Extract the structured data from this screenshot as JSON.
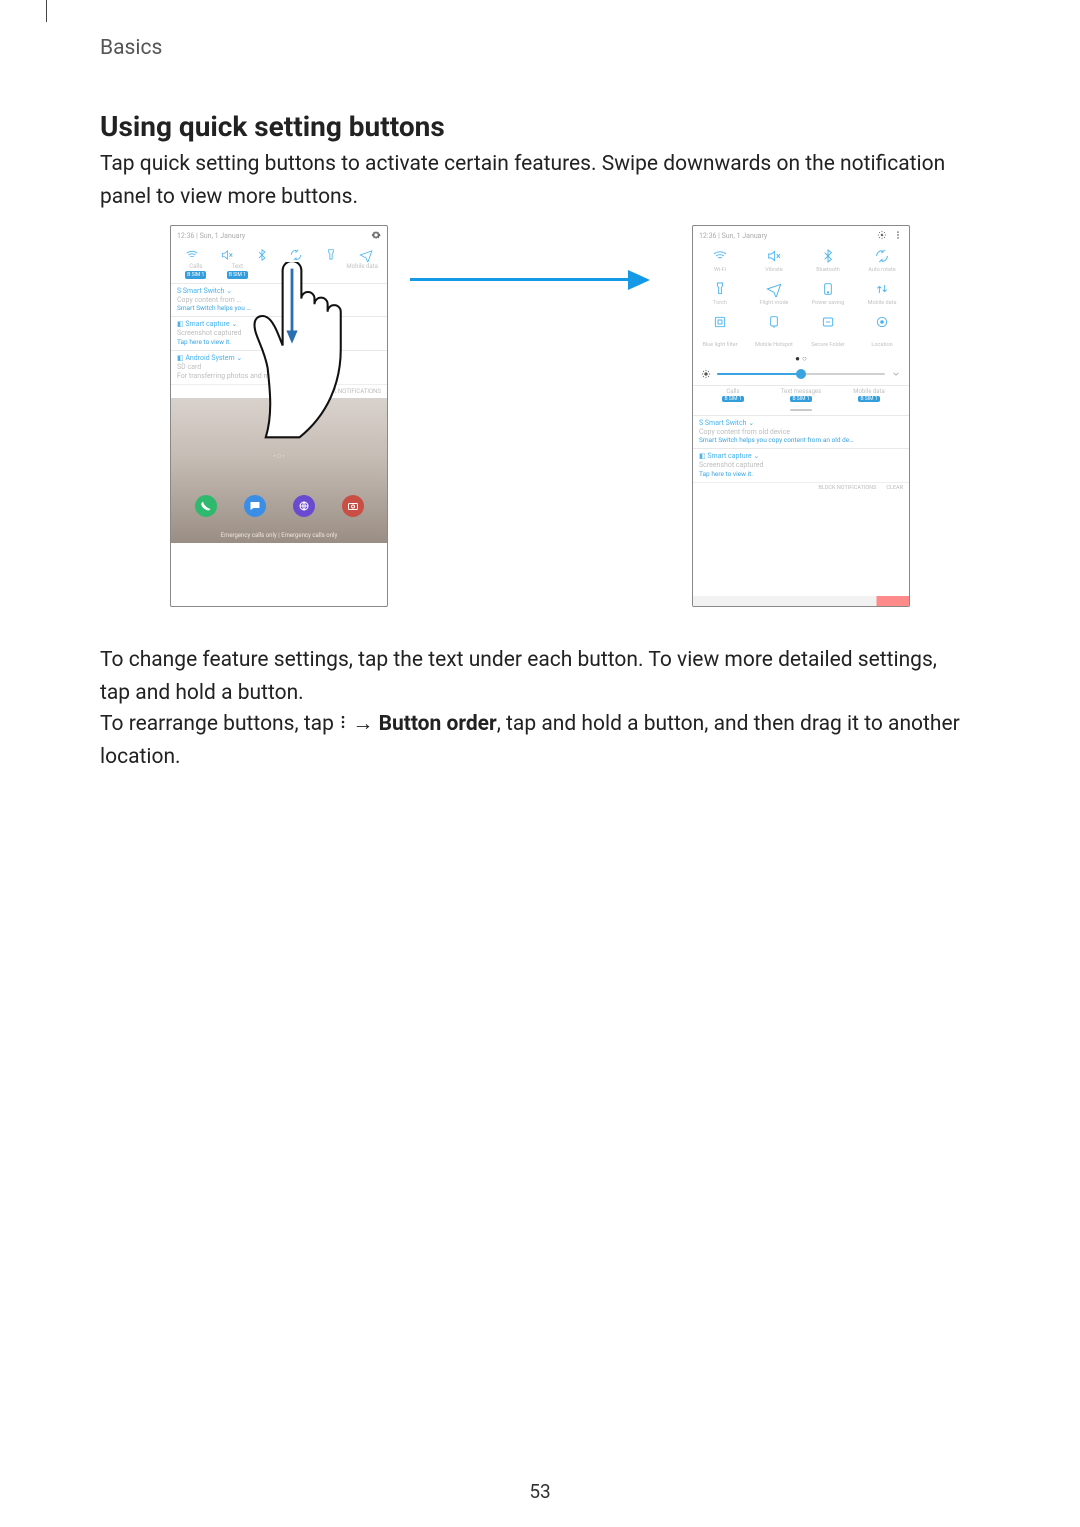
{
  "header": {
    "section": "Basics"
  },
  "heading": "Using quick setting buttons",
  "para1": "Tap quick setting buttons to activate certain features. Swipe downwards on the notification panel to view more buttons.",
  "para2": "To change feature settings, tap the text under each button. To view more detailed settings, tap and hold a button.",
  "para3_pre": "To rearrange buttons, tap ",
  "para3_arrow": " → ",
  "para3_bold": "Button order",
  "para3_post": ", tap and hold a button, and then drag it to another location.",
  "page_number": "53",
  "left_phone": {
    "time": "12:36 | Sun, 1 January",
    "sims": {
      "calls": "Calls",
      "texts": "Text",
      "data": "Mobile data",
      "sim": "B SIM 1"
    },
    "app1": {
      "name": "S  Smart Switch  ⌄",
      "line1": "Copy content from …",
      "line2": "Smart Switch helps you …"
    },
    "app2": {
      "name": "◧  Smart capture  ⌄",
      "line1": "Screenshot captured",
      "line2": "Tap here to view it."
    },
    "app3": {
      "name": "◧  Android System  ⌄",
      "line1": "SD card",
      "line2": "For transferring photos and media"
    },
    "block": "BLOCK NOTIFICATIONS",
    "emergency": "Emergency calls only | Emergency calls only"
  },
  "right_phone": {
    "time": "12:36 | Sun, 1 January",
    "qs": [
      "Wi-Fi",
      "Vibrate",
      "Bluetooth",
      "Auto rotate",
      "Torch",
      "Flight mode",
      "Power saving",
      "Mobile data",
      "",
      "",
      "",
      "",
      "Blue light filter",
      "Mobile Hotspot",
      "Secure Folder",
      "Location"
    ],
    "sims": {
      "calls": "Calls",
      "texts": "Text messages",
      "data": "Mobile data",
      "sim": "B SIM 1"
    },
    "app1": {
      "name": "S  Smart Switch  ⌄",
      "line1": "Copy content from old device",
      "line2": "Smart Switch helps you copy content from an old de…"
    },
    "app2": {
      "name": "◧  Smart capture  ⌄",
      "line1": "Screenshot captured",
      "line2": "Tap here to view it."
    },
    "block": "BLOCK NOTIFICATIONS",
    "clear": "CLEAR"
  }
}
